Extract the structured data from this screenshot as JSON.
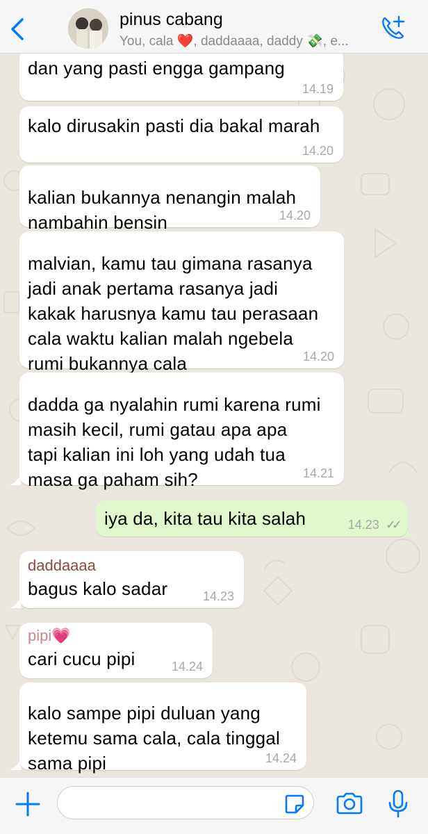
{
  "header": {
    "title": "pinus cabang",
    "members": "You, cala ❤️, daddaaaa, daddy 💸, e..."
  },
  "messages": [
    {
      "text": "dan yang pasti engga gampang",
      "time": "14.19"
    },
    {
      "text": "kalo dirusakin pasti dia bakal marah",
      "time": "14.20"
    },
    {
      "text": "kalian bukannya nenangin malah\nnambahin bensin",
      "time": "14.20"
    },
    {
      "text": "malvian, kamu tau gimana rasanya\njadi anak pertama rasanya jadi\nkakak harusnya kamu tau perasaan\ncala waktu kalian malah ngebela\nrumi bukannya cala",
      "time": "14.20"
    },
    {
      "text": "dadda ga nyalahin rumi karena rumi\nmasih kecil, rumi gatau apa apa\ntapi kalian ini loh yang udah tua\nmasa ga paham sih?",
      "time": "14.21"
    },
    {
      "text": "iya da, kita tau kita salah",
      "time": "14.23",
      "status": "✓✓"
    },
    {
      "sender": "daddaaaa",
      "sender_color": "#8b4a3c",
      "text": "bagus kalo sadar",
      "time": "14.23"
    },
    {
      "sender": "pipi💗",
      "sender_color": "#c48a8a",
      "text": "cari cucu pipi",
      "time": "14.24"
    },
    {
      "text": "kalo sampe pipi duluan yang\nketemu sama cala, cala tinggal\nsama pipi",
      "time": "14.24"
    }
  ],
  "input": {
    "placeholder": "",
    "value": ""
  },
  "colors": {
    "accent": "#007aff",
    "incoming": "#ffffff",
    "outgoing": "#e1f7cb"
  }
}
